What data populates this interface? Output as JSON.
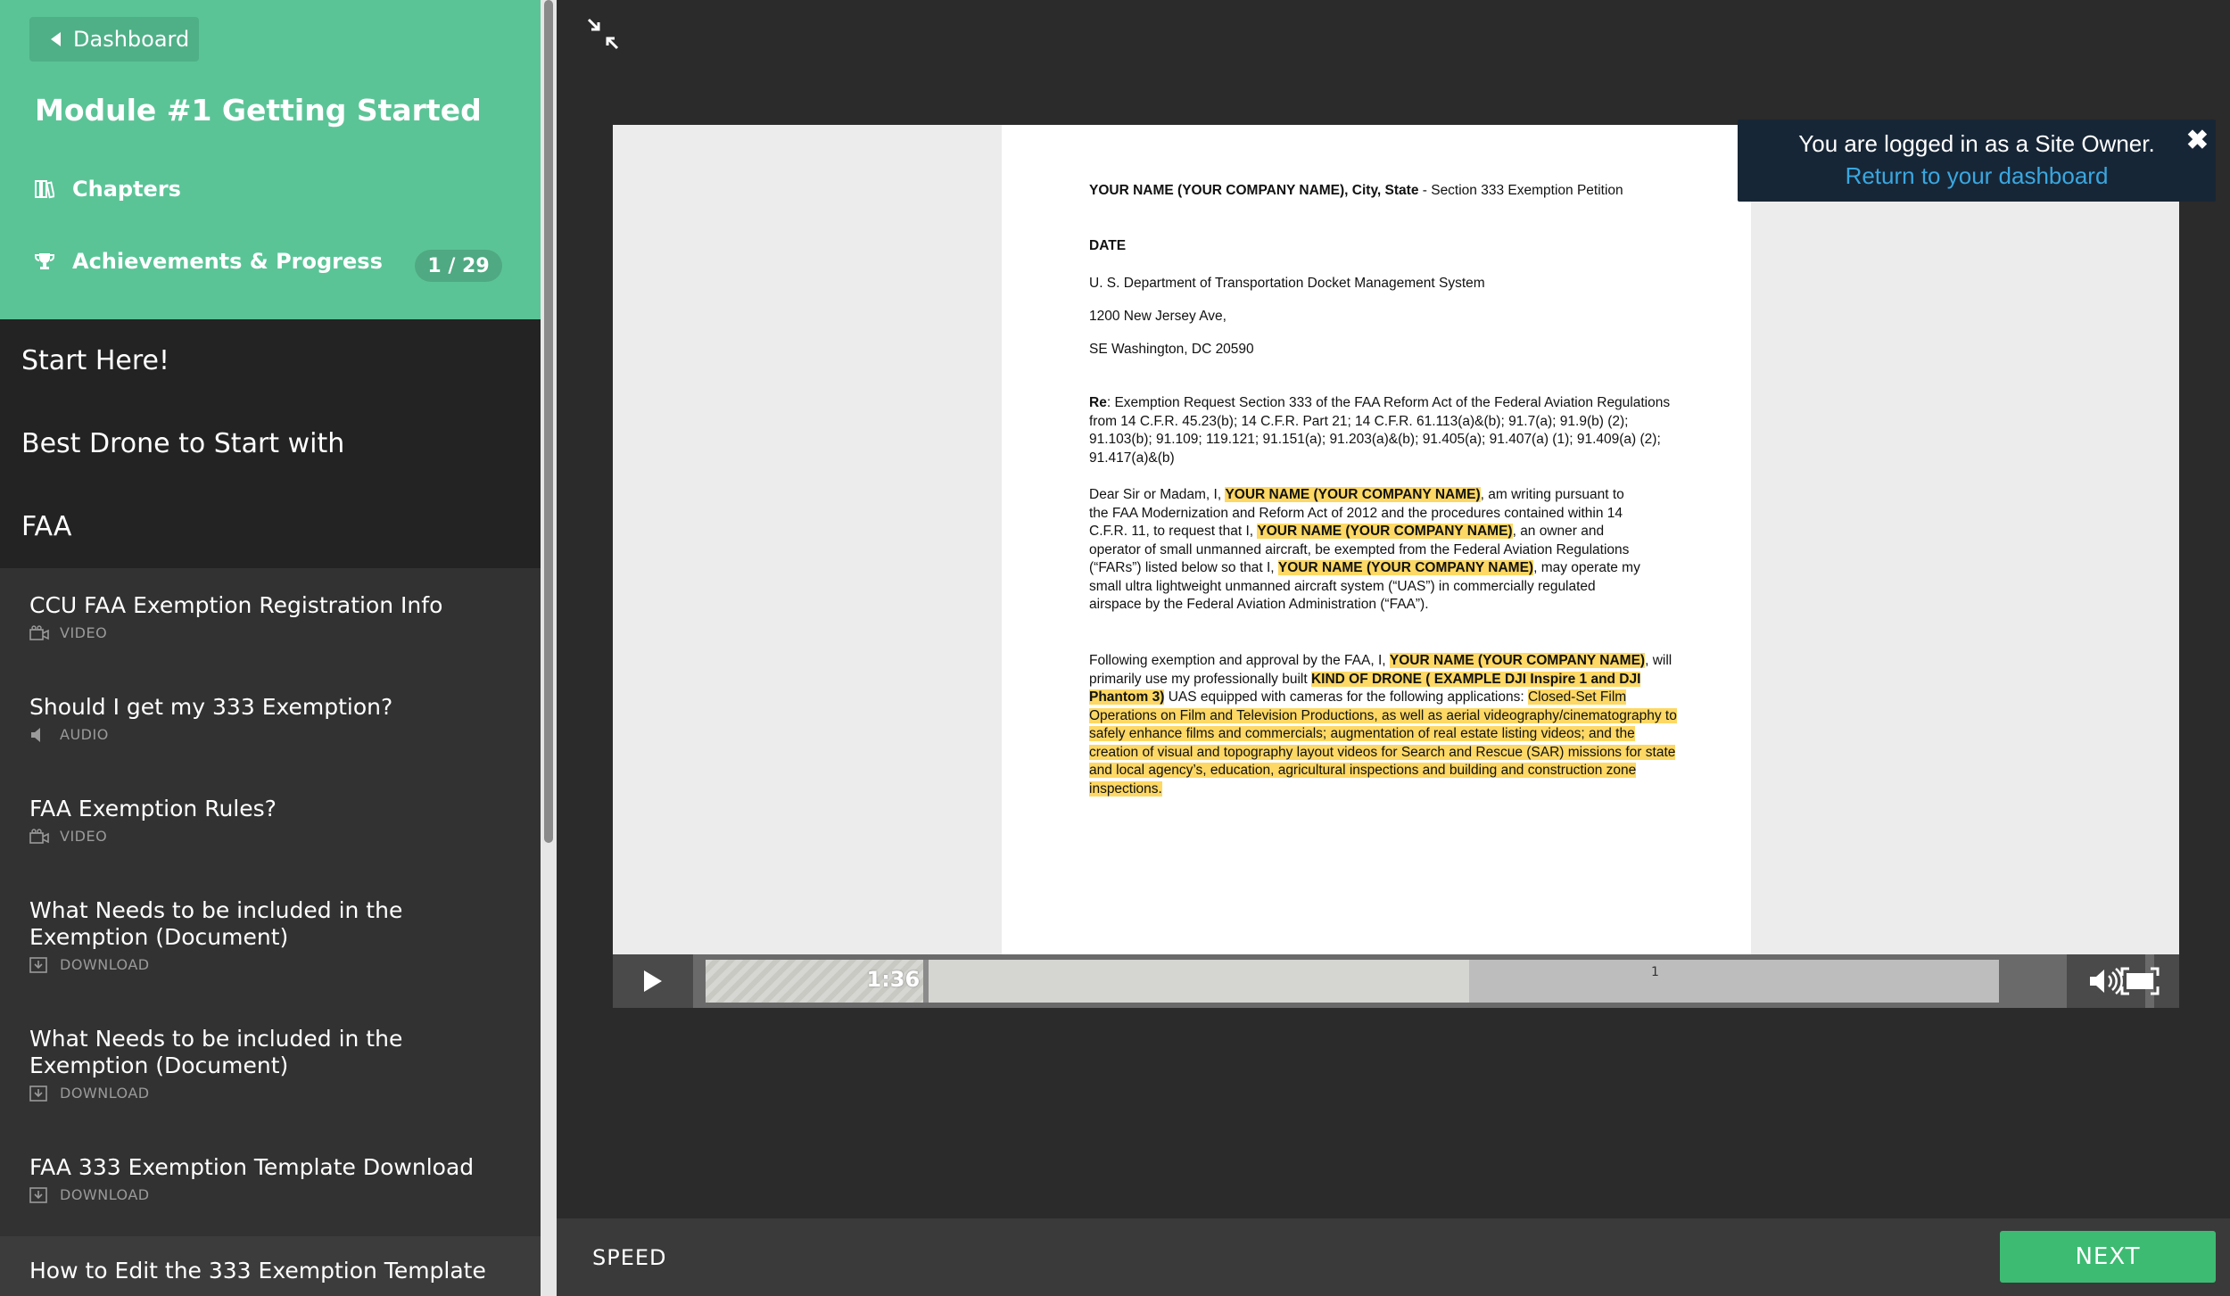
{
  "sidebar": {
    "dashboard_label": "Dashboard",
    "module_title": "Module #1 Getting Started",
    "chapters_label": "Chapters",
    "achievements_label": "Achievements & Progress",
    "progress_badge": "1 / 29",
    "chapters": [
      "Start Here!",
      "Best Drone to Start with",
      "FAA"
    ],
    "lessons": [
      {
        "title": "CCU FAA Exemption Registration Info",
        "kind": "VIDEO",
        "icon": "video-icon"
      },
      {
        "title": "Should I get my 333 Exemption?",
        "kind": "AUDIO",
        "icon": "audio-icon"
      },
      {
        "title": "FAA Exemption Rules?",
        "kind": "VIDEO",
        "icon": "video-icon"
      },
      {
        "title": "What Needs to be included in the Exemption (Document)",
        "kind": "DOWNLOAD",
        "icon": "download-icon"
      },
      {
        "title": "What Needs to be included in the Exemption (Document)",
        "kind": "DOWNLOAD",
        "icon": "download-icon"
      },
      {
        "title": "FAA 333 Exemption Template Download",
        "kind": "DOWNLOAD",
        "icon": "download-icon"
      },
      {
        "title": "How to Edit the 333 Exemption Template",
        "kind": "",
        "icon": "video-icon"
      }
    ]
  },
  "document": {
    "header_bold": "YOUR NAME (YOUR COMPANY NAME), City, State",
    "header_rest": " - Section 333 Exemption Petition",
    "date": "DATE",
    "addr1": "U. S. Department of Transportation Docket Management System",
    "addr2": "1200 New Jersey Ave,",
    "addr3": "SE Washington, DC 20590",
    "re_label": "Re",
    "re_text": ": Exemption Request Section 333 of the FAA Reform Act of the Federal Aviation Regulations from 14 C.F.R. 45.23(b); 14 C.F.R. Part 21; 14 C.F.R. 61.113(a)&(b); 91.7(a); 91.9(b) (2); 91.103(b); 91.109; 119.121; 91.151(a); 91.203(a)&(b); 91.405(a); 91.407(a) (1); 91.409(a) (2); 91.417(a)&(b)",
    "p1_a": "Dear Sir or Madam, I, ",
    "p1_hl1": "YOUR NAME (YOUR COMPANY NAME)",
    "p1_b": ", am writing pursuant to the FAA Modernization and Reform Act of 2012 and the procedures contained within 14 C.F.R. 11, to request that I, ",
    "p1_hl2": "YOUR NAME (YOUR COMPANY NAME)",
    "p1_c": ", an owner and operator of small unmanned aircraft, be exempted from the Federal Aviation Regulations (“FARs”) listed below so that I, ",
    "p1_hl3": "YOUR NAME (YOUR COMPANY NAME)",
    "p1_d": ", may operate my small ultra lightweight unmanned aircraft system (“UAS”) in commercially regulated airspace by the Federal Aviation Administration (“FAA”).",
    "p2_a": "Following exemption and approval by the FAA, I, ",
    "p2_hl1": "YOUR NAME (YOUR COMPANY NAME)",
    "p2_b": ", will primarily use my professionally built ",
    "p2_hl2": "KIND OF DRONE ( EXAMPLE DJI Inspire 1 and DJI Phantom 3)",
    "p2_c": " UAS equipped with cameras for the following applications: ",
    "p2_hl3": "Closed-Set Film Operations on Film and Television Productions, as well as aerial videography/cinematography to safely enhance films and commercials; augmentation of real estate listing videos; and the creation of visual and topography layout videos for Search and Rescue (SAR) missions for state and local agency’s, education, agricultural inspections and building and construction zone inspections."
  },
  "player": {
    "current_time": "1:36",
    "page_marker": "1",
    "progress": 0.17,
    "buffered": 0.59
  },
  "toast": {
    "message": "You are logged in as a Site Owner.",
    "link": "Return to your dashboard",
    "close": "✖"
  },
  "footer": {
    "speed_label": "SPEED",
    "next_label": "NEXT"
  },
  "colors": {
    "accent": "#5bc497",
    "next": "#3dbb73",
    "highlight": "#fdd864",
    "toast_bg": "#172636",
    "toast_link": "#3aa7e0"
  }
}
